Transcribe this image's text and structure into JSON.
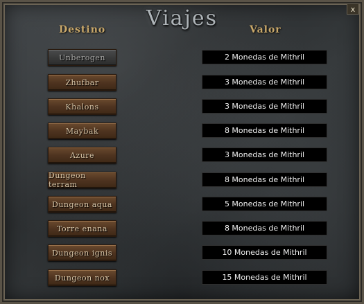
{
  "window": {
    "title": "Viajes",
    "close_label": "x"
  },
  "headers": {
    "destino": "Destino",
    "valor": "Valor"
  },
  "rows": [
    {
      "destination": "Unberogen",
      "cost": "2 Monedas de Mithril",
      "state": "disabled"
    },
    {
      "destination": "Zhufbar",
      "cost": "3 Monedas de Mithril",
      "state": "enabled"
    },
    {
      "destination": "Khalons",
      "cost": "3 Monedas de Mithril",
      "state": "enabled"
    },
    {
      "destination": "Maybak",
      "cost": "8 Monedas de Mithril",
      "state": "enabled"
    },
    {
      "destination": "Azure",
      "cost": "3 Monedas de Mithril",
      "state": "enabled"
    },
    {
      "destination": "Dungeon terram",
      "cost": "8 Monedas de Mithril",
      "state": "enabled"
    },
    {
      "destination": "Dungeon aqua",
      "cost": "5 Monedas de Mithril",
      "state": "enabled"
    },
    {
      "destination": "Torre enana",
      "cost": "8 Monedas de Mithril",
      "state": "enabled"
    },
    {
      "destination": "Dungeon ignis",
      "cost": "10 Monedas de Mithril",
      "state": "enabled"
    },
    {
      "destination": "Dungeon nox",
      "cost": "15 Monedas de Mithril",
      "state": "enabled"
    }
  ],
  "colors": {
    "button_enabled": "#5a3c24",
    "button_disabled": "#3c3d3d",
    "header_gold": "#c9a86a",
    "value_bg": "#000000"
  }
}
